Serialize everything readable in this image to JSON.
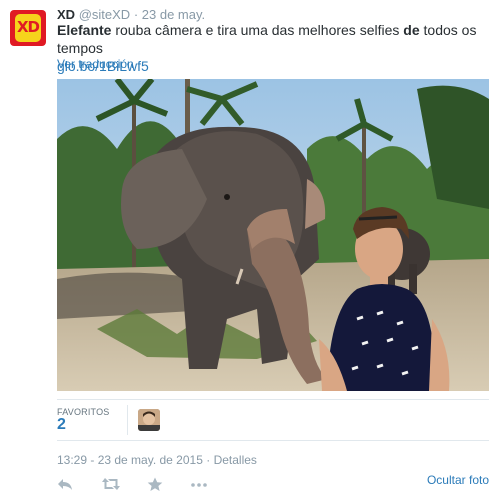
{
  "tweet": {
    "display_name": "XD",
    "screen_name": "@siteXD",
    "separator": "·",
    "timestamp": "23 de may.",
    "avatar_text": "XD",
    "text_bold_1": "Elefante",
    "text_mid": " rouba câmera e tira uma das melhores selfies ",
    "text_bold_2": "de",
    "text_end": " todos os tempos",
    "link": "glo.bo/1BiLwf5",
    "translate_label": "Ver traducción"
  },
  "stats": {
    "favorites_label": "FAVORITOS",
    "favorites_count": "2"
  },
  "footer": {
    "datetime": "13:29 - 23 de may. de 2015",
    "separator": " · ",
    "details_label": "Detalles",
    "hide_photo_label": "Ocultar foto"
  },
  "actions": [
    "reply-icon",
    "retweet-icon",
    "favorite-icon",
    "more-icon"
  ],
  "colors": {
    "link": "#2b7bb9",
    "muted": "#8899a6",
    "text": "#292f33",
    "brand_red": "#e01a24",
    "brand_yellow": "#f6d31c"
  }
}
